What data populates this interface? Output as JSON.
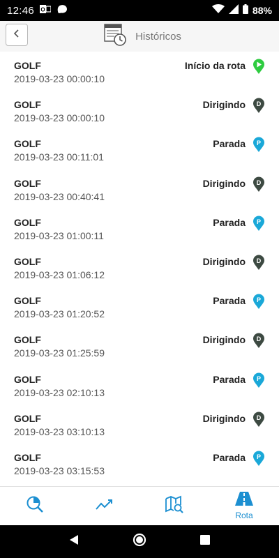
{
  "status_bar": {
    "time": "12:46",
    "battery": "88%"
  },
  "header": {
    "title": "Históricos"
  },
  "rows": [
    {
      "name": "GOLF",
      "time": "2019-03-23 00:00:10",
      "status": "Início da rota",
      "pin": "start"
    },
    {
      "name": "GOLF",
      "time": "2019-03-23 00:00:10",
      "status": "Dirigindo",
      "pin": "D"
    },
    {
      "name": "GOLF",
      "time": "2019-03-23 00:11:01",
      "status": "Parada",
      "pin": "P"
    },
    {
      "name": "GOLF",
      "time": "2019-03-23 00:40:41",
      "status": "Dirigindo",
      "pin": "D"
    },
    {
      "name": "GOLF",
      "time": "2019-03-23 01:00:11",
      "status": "Parada",
      "pin": "P"
    },
    {
      "name": "GOLF",
      "time": "2019-03-23 01:06:12",
      "status": "Dirigindo",
      "pin": "D"
    },
    {
      "name": "GOLF",
      "time": "2019-03-23 01:20:52",
      "status": "Parada",
      "pin": "P"
    },
    {
      "name": "GOLF",
      "time": "2019-03-23 01:25:59",
      "status": "Dirigindo",
      "pin": "D"
    },
    {
      "name": "GOLF",
      "time": "2019-03-23 02:10:13",
      "status": "Parada",
      "pin": "P"
    },
    {
      "name": "GOLF",
      "time": "2019-03-23 03:10:13",
      "status": "Dirigindo",
      "pin": "D"
    },
    {
      "name": "GOLF",
      "time": "2019-03-23 03:15:53",
      "status": "Parada",
      "pin": "P"
    }
  ],
  "bottom_nav": {
    "items": [
      {
        "icon": "search-chart-icon",
        "label": ""
      },
      {
        "icon": "trend-line-icon",
        "label": ""
      },
      {
        "icon": "map-search-icon",
        "label": ""
      },
      {
        "icon": "road-icon",
        "label": "Rota"
      }
    ]
  },
  "colors": {
    "accent": "#1c8fd1",
    "pin_start": "#2ecc40",
    "pin_driving": "#3d4a42",
    "pin_parked": "#1aa8d8"
  }
}
